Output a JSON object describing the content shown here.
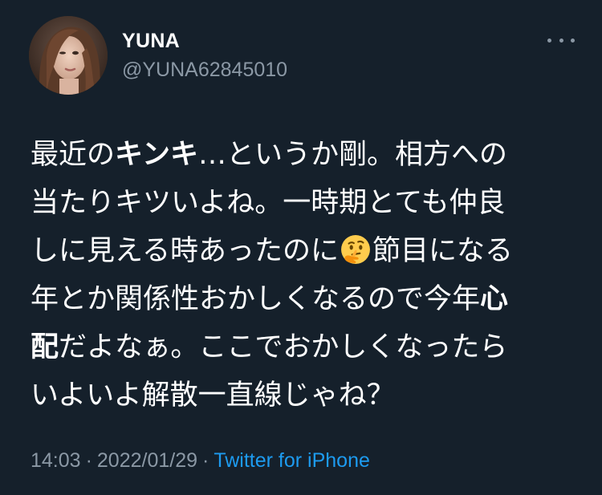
{
  "author": {
    "name": "YUNA",
    "handle": "@YUNA62845010"
  },
  "tweet": {
    "lines": [
      [
        "最近の",
        "キンキ",
        "…というか剛。相方への"
      ],
      [
        "当たりキツいよね。一時期とても仲良"
      ],
      [
        "しに見える時あったのに",
        "[thinking-face-emoji]",
        "節目になる"
      ],
      [
        "年とか関係性おかしくなるので今年",
        "心"
      ],
      [
        "配",
        "だよなぁ。ここでおかしくなったら"
      ],
      [
        "いよいよ解散一直線じゃね？"
      ]
    ]
  },
  "meta": {
    "time": "14:03",
    "separator": "·",
    "date": "2022/01/29",
    "source": "Twitter for iPhone"
  },
  "icons": {
    "more": "more-horizontal-icon",
    "emoji": "thinking-face-emoji"
  },
  "colors": {
    "background": "#15202b",
    "text": "#ffffff",
    "secondary": "#8b98a5",
    "link": "#1d9bf0"
  }
}
